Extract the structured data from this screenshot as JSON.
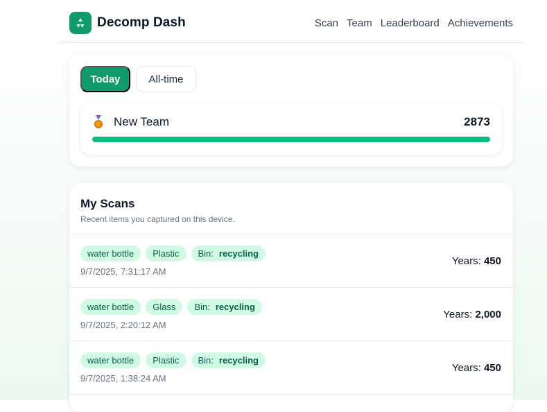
{
  "header": {
    "brand": "Decomp Dash",
    "nav": [
      "Scan",
      "Team",
      "Leaderboard",
      "Achievements"
    ]
  },
  "toggle": {
    "today": "Today",
    "alltime": "All-time",
    "selected": "Today"
  },
  "team": {
    "name": "New Team",
    "score": "2873",
    "progress_pct": 100,
    "medal_icon": "medal-icon"
  },
  "scans": {
    "title": "My Scans",
    "subtitle": "Recent items you captured on this device.",
    "bin_label": "Bin:",
    "years_label": "Years:",
    "items": [
      {
        "item": "water bottle",
        "material": "Plastic",
        "bin": "recycling",
        "time": "9/7/2025, 7:31:17 AM",
        "years": "450"
      },
      {
        "item": "water bottle",
        "material": "Glass",
        "bin": "recycling",
        "time": "9/7/2025, 2:20:12 AM",
        "years": "2,000"
      },
      {
        "item": "water bottle",
        "material": "Plastic",
        "bin": "recycling",
        "time": "9/7/2025, 1:38:24 AM",
        "years": "450"
      }
    ]
  },
  "colors": {
    "accent": "#0f9b6a",
    "bar": "#10b981",
    "chip_bg": "#d1fae5",
    "chip_text": "#065f46"
  }
}
